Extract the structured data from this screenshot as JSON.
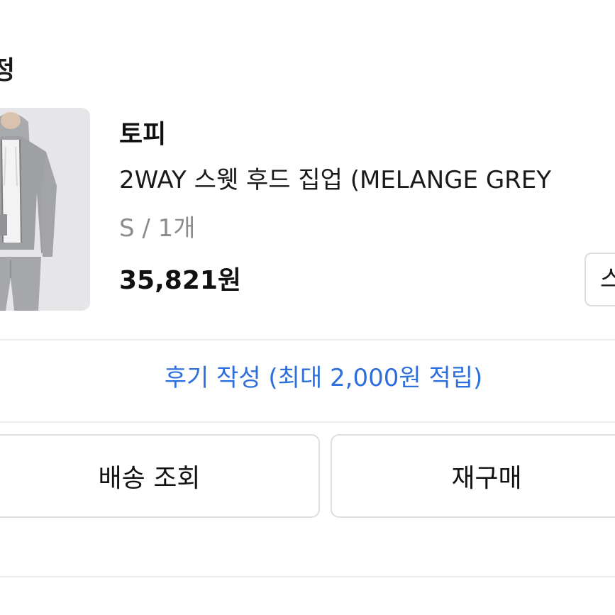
{
  "header": {
    "status_label": "정"
  },
  "order": {
    "brand": "토피",
    "product_name": "2WAY 스웻 후드 집업 (MELANGE GREY",
    "option": "S / 1개",
    "price": "35,821원",
    "side_button_label": "스"
  },
  "review": {
    "label": "후기 작성 (최대 2,000원 적립)",
    "color": "#2f6fdb"
  },
  "actions": {
    "track_label": "배송 조회",
    "rebuy_label": "재구매"
  },
  "image": {
    "icon": "product-photo-grey-hoodie"
  }
}
